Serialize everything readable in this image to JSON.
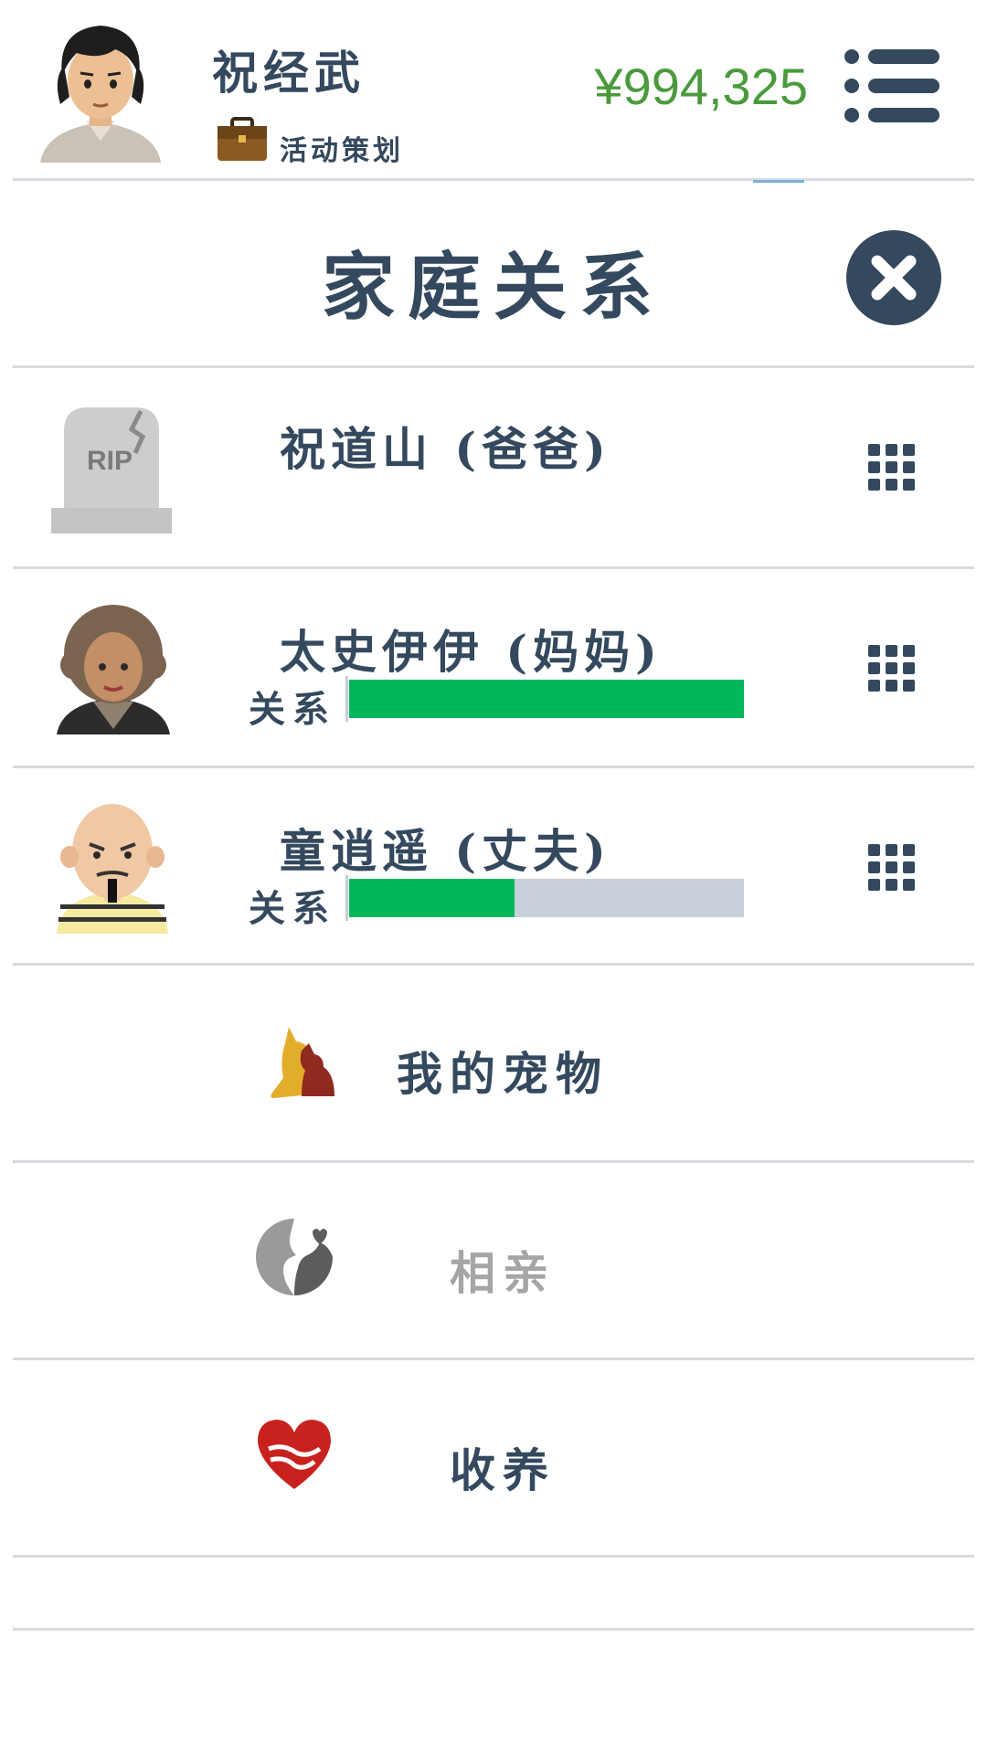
{
  "header": {
    "player_name": "祝经武",
    "job": "活动策划",
    "money": "¥994,325"
  },
  "dialog": {
    "title": "家庭关系"
  },
  "family": [
    {
      "name": "祝道山 (爸爸)",
      "deceased": true,
      "avatar_text": "RIP"
    },
    {
      "name": "太史伊伊 (妈妈)",
      "relation_label": "关系",
      "relation_level": 1.0
    },
    {
      "name": "童逍遥 (丈夫)",
      "relation_label": "关系",
      "relation_level": 0.42
    }
  ],
  "actions": [
    {
      "label": "我的宠物",
      "enabled": true,
      "icon": "pet-icon"
    },
    {
      "label": "相亲",
      "enabled": false,
      "icon": "dating-icon"
    },
    {
      "label": "收养",
      "enabled": true,
      "icon": "adopt-heart-icon"
    }
  ],
  "colors": {
    "primary": "#34495e",
    "money": "#4a9a3c",
    "relation_fill": "#00b85a",
    "relation_track": "#c8d1da",
    "disabled": "#a5a5a5"
  }
}
